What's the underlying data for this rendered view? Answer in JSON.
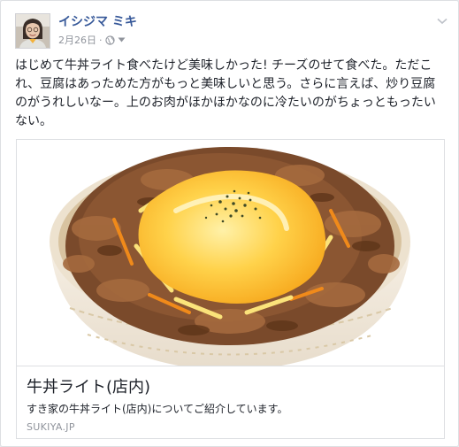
{
  "post": {
    "author": "イシジマ ミキ",
    "date": "2月26日",
    "separator": "·",
    "text": "はじめて牛丼ライト食べたけど美味しかった! チーズのせて食べた。ただこれ、豆腐はあっためた方がもっと美味しいと思う。さらに言えば、炒り豆腐のがうれしいなー。上のお肉がほかほかなのに冷たいのがちょっともったいない。"
  },
  "link": {
    "title": "牛丼ライト(店内)",
    "description": "すき家の牛丼ライト(店内)についてご紹介しています。",
    "domain": "SUKIYA.JP"
  },
  "icons": {
    "menu": "chevron-down-icon",
    "audience": "globe-icon",
    "audience_menu": "caret-down-icon"
  },
  "colors": {
    "author_link": "#365899",
    "meta_text": "#90949c",
    "body_text": "#1d2129",
    "border": "#dddfe2"
  }
}
